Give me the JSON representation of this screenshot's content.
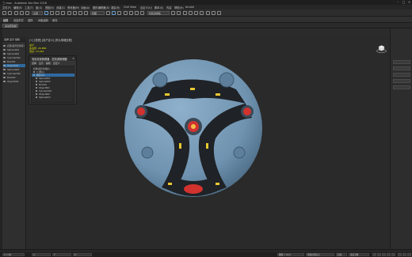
{
  "window": {
    "title": "三.max - Autodesk 3ds Max 2018",
    "controls": [
      "–",
      "□",
      "×"
    ]
  },
  "menubar": {
    "items": [
      "文件(F)",
      "编辑(E)",
      "工具(T)",
      "组(G)",
      "视图(V)",
      "创建(C)",
      "修改器(M)",
      "动画(A)",
      "图形编辑器(D)",
      "渲染(R)",
      "Civil View",
      "自定义(U)",
      "脚本(S)",
      "内容",
      "帮助(H)",
      "Arnold"
    ]
  },
  "toolbar": {
    "filter_dropdown": "全部",
    "view_dropdown": "视图",
    "selection_set": "创建选择集"
  },
  "ribbon": {
    "tabs": [
      "建模",
      "自由形式",
      "选择",
      "对象绘制",
      "填充"
    ]
  },
  "sub_ribbon": {
    "mode_label": "多边形建模"
  },
  "scene_explorer": {
    "title": "选择  显示  编辑",
    "items": [
      {
        "name": "名称(按升序排序)",
        "selected": false
      },
      {
        "name": "Sphere001",
        "selected": false
      },
      {
        "name": "Sphere002",
        "selected": false
      },
      {
        "name": "Cylinder001",
        "selected": false
      },
      {
        "name": "Box001",
        "selected": false
      },
      {
        "name": "Object001",
        "selected": true
      },
      {
        "name": "Sphere003",
        "selected": false
      },
      {
        "name": "Cylinder002",
        "selected": false
      },
      {
        "name": "Box002",
        "selected": false
      },
      {
        "name": "Object002",
        "selected": false
      }
    ]
  },
  "viewport": {
    "label": "[+] [透视] [用户定义] [默认明暗处理]",
    "stats_total_label": "总计",
    "stats": [
      "多边形: 26,880",
      "顶点:    13,442"
    ]
  },
  "floating_panel": {
    "title": "场景资源管理器 - 层资源管理器",
    "menu": [
      "选择",
      "显示",
      "编辑",
      "自定义"
    ],
    "rows": [
      {
        "name": "名称(按升序排序)",
        "indent": 0,
        "selected": false
      },
      {
        "name": "0 (默认)",
        "indent": 1,
        "selected": false
      },
      {
        "name": "图层001",
        "indent": 1,
        "selected": true
      },
      {
        "name": "Sphere001",
        "indent": 2,
        "selected": false
      },
      {
        "name": "Sphere002",
        "indent": 2,
        "selected": false
      },
      {
        "name": "Box001",
        "indent": 2,
        "selected": false
      },
      {
        "name": "Object001",
        "indent": 2,
        "selected": false
      },
      {
        "name": "Cylinder001",
        "indent": 2,
        "selected": false
      },
      {
        "name": "Object002",
        "indent": 2,
        "selected": false
      },
      {
        "name": "Sphere003",
        "indent": 2,
        "selected": false
      }
    ]
  },
  "status": {
    "frame_field": "0 / 100",
    "coord_x": "X:",
    "coord_y": "Y:",
    "coord_z": "Z:",
    "grid": "栅格 = 10.0",
    "add_time_tag": "添加时间标记",
    "auto_key": "自动",
    "selection_label": "选定对象"
  },
  "colors": {
    "sphere_body": "#7396b4",
    "frame": "#1f2226",
    "accent_red": "#d2332f",
    "accent_yellow": "#e9c832",
    "selection_blue": "#2f6aa0"
  }
}
